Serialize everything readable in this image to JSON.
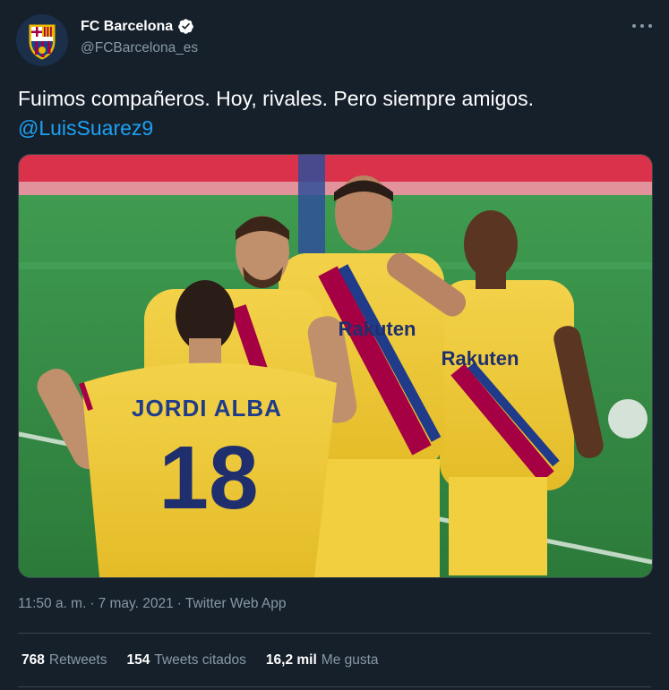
{
  "author": {
    "display_name": "FC Barcelona",
    "handle": "@FCBarcelona_es",
    "verified": true
  },
  "tweet": {
    "text": "Fuimos compañeros. Hoy, rivales. Pero siempre amigos.",
    "mention": "@LuisSuarez9",
    "photo": {
      "jersey_name": "JORDI ALBA",
      "jersey_number": "18",
      "sponsor": "Rakuten"
    }
  },
  "meta": {
    "time": "11:50 a. m.",
    "separator": "·",
    "date": "7 may. 2021",
    "source": "Twitter Web App"
  },
  "stats": {
    "retweets": {
      "value": "768",
      "label": "Retweets"
    },
    "quotes": {
      "value": "154",
      "label": "Tweets citados"
    },
    "likes": {
      "value": "16,2 mil",
      "label": "Me gusta"
    }
  },
  "icons": [
    "fcb-crest-icon",
    "verified-badge-icon",
    "more-options-icon"
  ],
  "colors": {
    "background": "#15202b",
    "link": "#1da1f2",
    "secondary_text": "#8899a6",
    "divider": "#38444d"
  }
}
